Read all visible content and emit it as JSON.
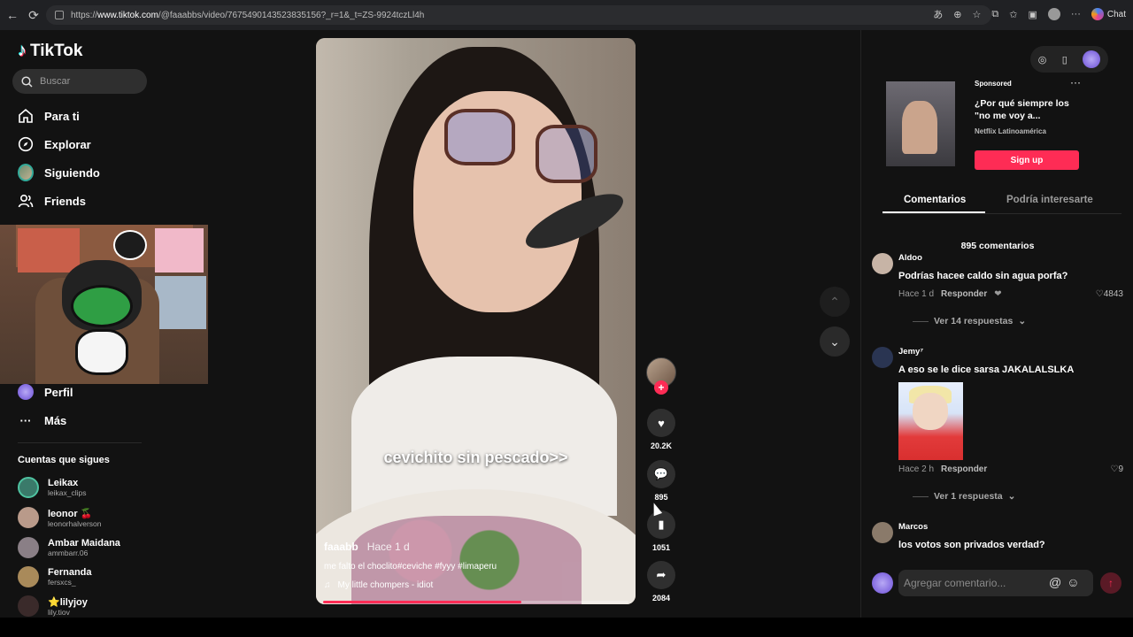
{
  "browser": {
    "url_prefix": "https://",
    "url_host": "www.tiktok.com",
    "url_path": "/@faaabbs/video/7675490143523835156?_r=1&_t=ZS-9924tczLl4h",
    "chat_label": "Chat"
  },
  "sidebar": {
    "logo_text": "TikTok",
    "search_placeholder": "Buscar",
    "nav": [
      {
        "label": "Para ti",
        "icon": "home-icon"
      },
      {
        "label": "Explorar",
        "icon": "compass-icon"
      },
      {
        "label": "Siguiendo",
        "icon": "following-avatar"
      },
      {
        "label": "Friends",
        "icon": "friends-icon"
      },
      {
        "label": "Perfil",
        "icon": "profile-avatar"
      },
      {
        "label": "Más",
        "icon": "more-icon"
      }
    ],
    "following_title": "Cuentas que sigues",
    "following": [
      {
        "name": "Leikax",
        "handle": "leikax_clips",
        "color": "#3a7a6a"
      },
      {
        "name": "leonor 🍒",
        "handle": "leonorhalverson",
        "color": "#b99a8a"
      },
      {
        "name": "Ambar Maidana",
        "handle": "ammbarr.06",
        "color": "#8a7f86"
      },
      {
        "name": "Fernanda",
        "handle": "fersxcs_",
        "color": "#a98a5a"
      },
      {
        "name": "⭐lilyjoy",
        "handle": "lily.tiov",
        "color": "#3a2a2a"
      }
    ]
  },
  "video": {
    "caption_overlay": "cevichito sin pescado>>",
    "author": "faaabb",
    "posted": "Hace 1 d",
    "description": "me falto el choclito#ceviche #fyyy #limaperu",
    "music": "My little chompers - idiot",
    "progress_fraction": 0.65
  },
  "actions": {
    "likes": "20.2K",
    "comments": "895",
    "saves": "1051",
    "shares": "2084"
  },
  "ad": {
    "sponsored_label": "Sponsored",
    "title": "¿Por qué siempre los \"no me voy a...",
    "brand": "Netflix Latinoamérica",
    "cta": "Sign up"
  },
  "tabs": {
    "comments": "Comentarios",
    "recommended": "Podría interesarte"
  },
  "comments": {
    "count_label": "895 comentarios",
    "items": [
      {
        "user": "Aldoo",
        "text": "Podrías hacee caldo sin agua porfa?",
        "time": "Hace 1 d",
        "reply": "Responder",
        "likes": "4843",
        "replies": "Ver 14 respuestas"
      },
      {
        "user": "Jemy⁷",
        "text": "A eso se le dice sarsa JAKALALSLKA",
        "time": "Hace 2 h",
        "reply": "Responder",
        "likes": "9",
        "replies": "Ver 1 respuesta"
      },
      {
        "user": "Marcos",
        "text": "los votos son privados verdad?"
      }
    ],
    "add_placeholder": "Agregar comentario..."
  }
}
